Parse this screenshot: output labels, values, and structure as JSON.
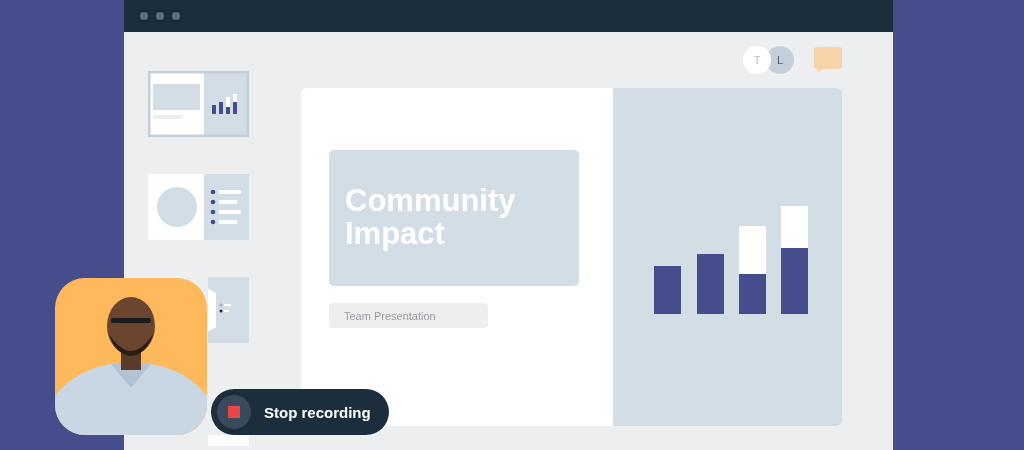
{
  "collaborators": [
    {
      "initial": "T",
      "kind": "light"
    },
    {
      "initial": "L",
      "kind": "muted"
    }
  ],
  "slides": [
    {
      "kind": "chart",
      "selected": true
    },
    {
      "kind": "bullets",
      "selected": false
    },
    {
      "kind": "diagram",
      "selected": false
    },
    {
      "kind": "blank",
      "selected": false
    }
  ],
  "slide": {
    "title": "Community Impact",
    "subtitle": "Team Presentation"
  },
  "record_button": {
    "label": "Stop recording"
  }
}
